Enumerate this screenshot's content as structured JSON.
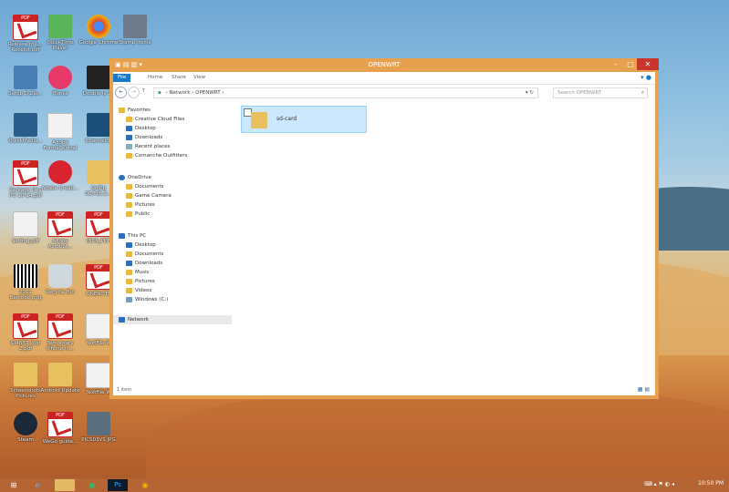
{
  "desktop": {
    "icons": [
      {
        "id": "adobe-pdf-1",
        "label": "Release of L... Receipt.pdf",
        "type": "pdf"
      },
      {
        "id": "quicktime",
        "label": "QuickTime Player",
        "type": "app"
      },
      {
        "id": "chrome",
        "label": "Google Chrome",
        "type": "app"
      },
      {
        "id": "steam-icon-top",
        "label": "Stamp Items",
        "type": "app"
      },
      {
        "id": "dotpdf",
        "label": "Setup D.Zip...",
        "type": "app"
      },
      {
        "id": "itunes",
        "label": "iTunes",
        "type": "app"
      },
      {
        "id": "double-file",
        "label": "Double is 77",
        "type": "app"
      },
      {
        "id": "quickmedia",
        "label": "QuickMedia...",
        "type": "app"
      },
      {
        "id": "adobe-formscentral",
        "label": "Adobe FormsCentral",
        "type": "app"
      },
      {
        "id": "channel",
        "label": "ChannelOf",
        "type": "app"
      },
      {
        "id": "package-dev",
        "label": "Package Dev PO 10-14.pdf",
        "type": "pdf"
      },
      {
        "id": "adobe-create",
        "label": "Adobe Creati...",
        "type": "app"
      },
      {
        "id": "unzip",
        "label": "UnZip 06.Feb.2...",
        "type": "app"
      },
      {
        "id": "settings-pdf",
        "label": "Setting.pdf",
        "type": "pdf"
      },
      {
        "id": "adobe-acrobat",
        "label": "Adobe Acrobat...",
        "type": "pdf"
      },
      {
        "id": "ibx-pdf",
        "label": "IBX3_PDF",
        "type": "pdf"
      },
      {
        "id": "barcode",
        "label": "2011 Barcode.png",
        "type": "img"
      },
      {
        "id": "recycle",
        "label": "Recycle Bin",
        "type": "bin"
      },
      {
        "id": "onenote",
        "label": "ONENOTE",
        "type": "pdf"
      },
      {
        "id": "gi-pdf",
        "label": "GI4853 Post 2.pdf",
        "type": "pdf"
      },
      {
        "id": "temporary",
        "label": "Temporary iPhone in...",
        "type": "pdf"
      },
      {
        "id": "textfile",
        "label": "TextFile W",
        "type": "doc"
      },
      {
        "id": "screenshots",
        "label": "Screenshots Pictures",
        "type": "folder"
      },
      {
        "id": "android",
        "label": "Android Update",
        "type": "folder"
      },
      {
        "id": "textfile2",
        "label": "TextFile W",
        "type": "doc"
      },
      {
        "id": "steam",
        "label": "Steam",
        "type": "app"
      },
      {
        "id": "wego",
        "label": "WeGo guide...",
        "type": "pdf"
      },
      {
        "id": "pics",
        "label": "PICS03VS.JPG",
        "type": "img"
      }
    ]
  },
  "window": {
    "title": "OPENWRT",
    "ribbon": {
      "file": "File",
      "tabs": [
        "Home",
        "Share",
        "View"
      ]
    },
    "address": {
      "path": [
        "Network",
        "OPENWRT"
      ],
      "search_placeholder": "Search OPENWRT"
    },
    "nav": {
      "favorites_label": "Favorites",
      "favorites": [
        "Creative Cloud Files",
        "Desktop",
        "Downloads",
        "Recent places",
        "Comanche Outfitters"
      ],
      "onedrive_label": "OneDrive",
      "onedrive": [
        "Documents",
        "Game Camera",
        "Pictures",
        "Public"
      ],
      "thispc_label": "This PC",
      "thispc": [
        "Desktop",
        "Documents",
        "Downloads",
        "Music",
        "Pictures",
        "Videos",
        "Windows (C:)"
      ],
      "network_label": "Network"
    },
    "content": {
      "items": [
        {
          "name": "sd-card"
        }
      ]
    },
    "status": {
      "count": "1 item"
    }
  },
  "taskbar": {
    "time": "10:50 PM"
  },
  "colors": {
    "accent": "#e7a14e",
    "file_tab": "#1979ca",
    "taskbar": "#b56434"
  }
}
